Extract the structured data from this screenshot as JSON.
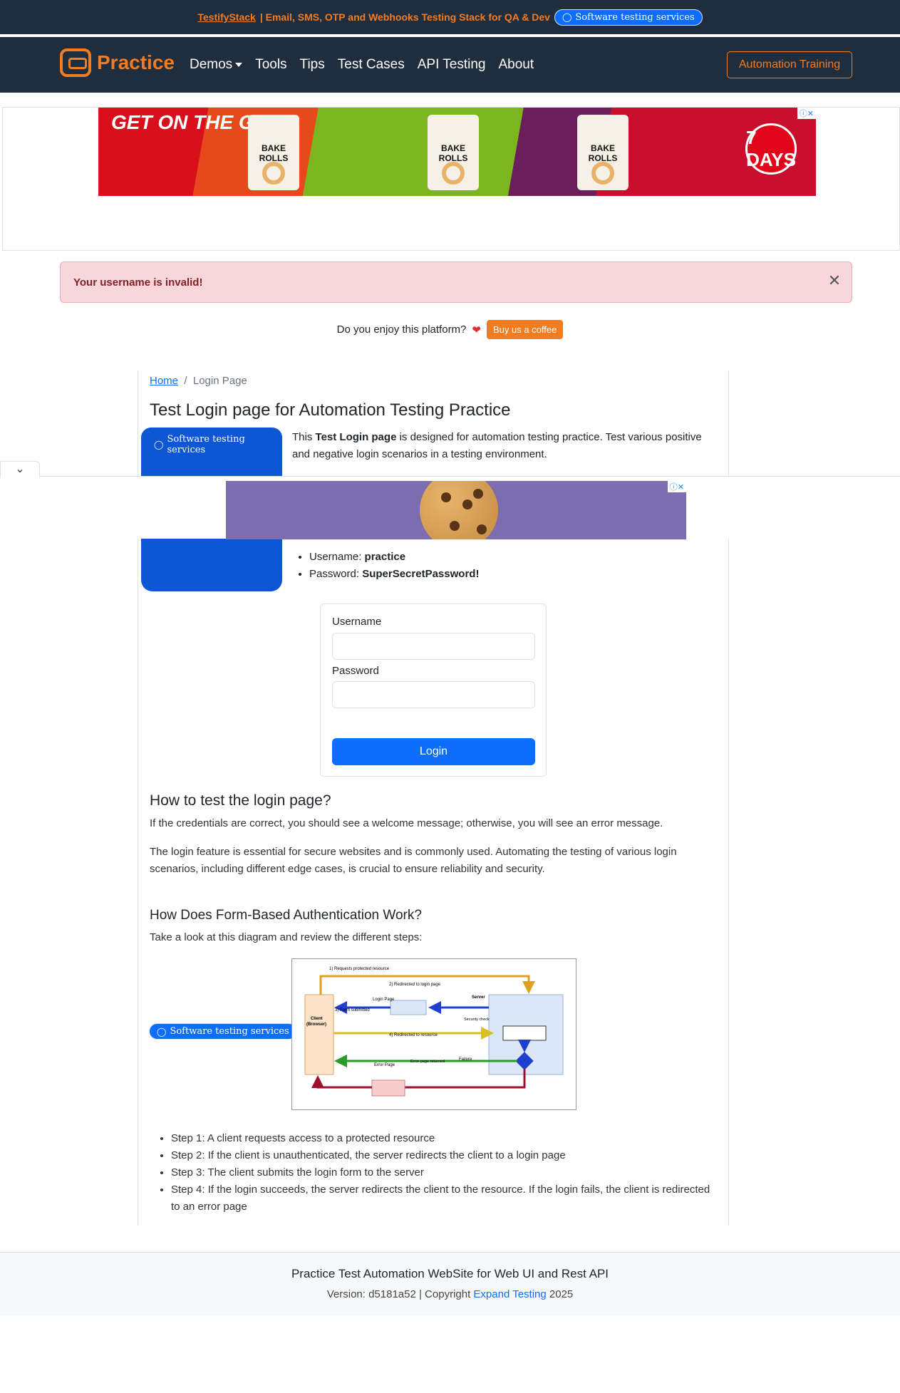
{
  "topbar": {
    "brand": "TestifyStack",
    "tagline": "| Email, SMS, OTP and Webhooks Testing Stack for QA & Dev",
    "pill": "Software testing services"
  },
  "nav": {
    "logo": "Practice",
    "items": [
      "Demos",
      "Tools",
      "Tips",
      "Test Cases",
      "API Testing",
      "About"
    ],
    "cta": "Automation Training"
  },
  "ad1": {
    "slogan": "GET ON THE GO",
    "bags": [
      "BAKE ROLLS",
      "BAKE ROLLS",
      "BAKE ROLLS"
    ],
    "badge": "7 DAYS"
  },
  "alert": {
    "message": "Your username is invalid!"
  },
  "coffee": {
    "question": "Do you enjoy this platform?",
    "button": "Buy us a coffee"
  },
  "breadcrumb": {
    "home": "Home",
    "current": "Login Page"
  },
  "page": {
    "title": "Test Login page for Automation Testing Practice",
    "side_pill": "Software testing services",
    "intro_pre": "This ",
    "intro_bold": "Test Login page",
    "intro_post": " is designed for automation testing practice. Test various positive and negative login scenarios in a testing environment.",
    "cred_user_label": "Username: ",
    "cred_user": "practice",
    "cred_pass_label": "Password: ",
    "cred_pass": "SuperSecretPassword!"
  },
  "form": {
    "username_label": "Username",
    "username_value": "",
    "password_label": "Password",
    "password_value": "",
    "submit": "Login"
  },
  "howto": {
    "heading": "How to test the login page?",
    "p1": "If the credentials are correct, you should see a welcome message; otherwise, you will see an error message.",
    "p2": "The login feature is essential for secure websites and is commonly used. Automating the testing of various login scenarios, including different edge cases, is crucial to ensure reliability and security."
  },
  "auth": {
    "heading": "How Does Form-Based Authentication Work?",
    "intro": "Take a look at this diagram and review the different steps:",
    "pill": "Software testing services",
    "diagram": {
      "step1": "1) Requests protected resource",
      "step2": "2) Redirected to login page",
      "step3": "3) Form submitted",
      "step4": "4) Redirected to resource",
      "client": "Client",
      "browser": "(Browser)",
      "server": "Server",
      "login_page": "Login Page",
      "security_check": "Security check",
      "error_page": "Error Page",
      "error_returned": "Error page returned",
      "failure": "Failure",
      "decision": "?"
    },
    "steps": [
      "Step 1: A client requests access to a protected resource",
      "Step 2: If the client is unauthenticated, the server redirects the client to a login page",
      "Step 3: The client submits the login form to the server",
      "Step 4: If the login succeeds, the server redirects the client to the resource. If the login fails, the client is redirected to an error page"
    ]
  },
  "footer": {
    "title": "Practice Test Automation WebSite for Web UI and Rest API",
    "version_pre": "Version: d5181a52 | Copyright ",
    "link": "Expand Testing",
    "year": " 2025"
  }
}
